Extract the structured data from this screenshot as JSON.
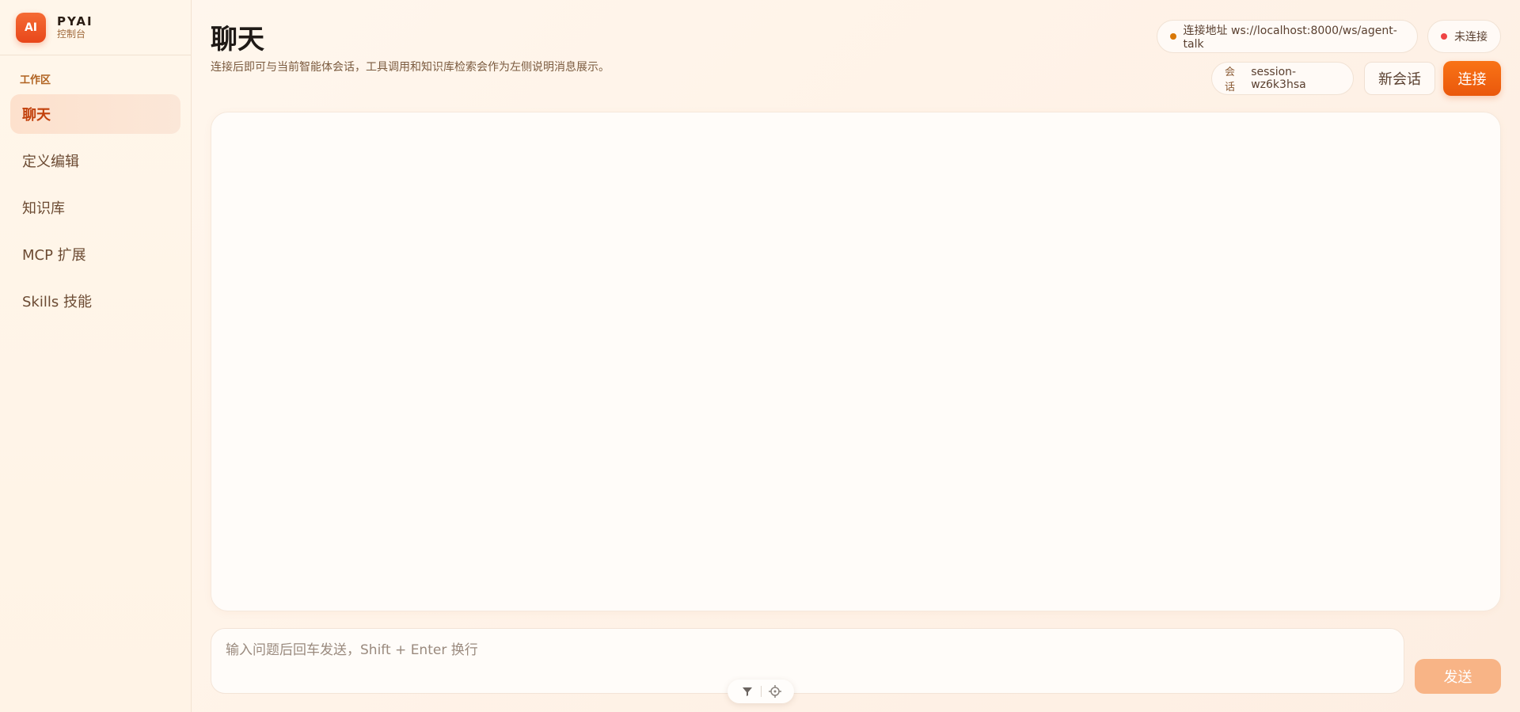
{
  "brand": {
    "logo": "AI",
    "name": "PYAI",
    "subtitle": "控制台"
  },
  "sidebar": {
    "section_label": "工作区",
    "items": [
      {
        "label": "聊天",
        "active": true
      },
      {
        "label": "定义编辑"
      },
      {
        "label": "知识库"
      },
      {
        "label": "MCP 扩展"
      },
      {
        "label": "Skills 技能"
      }
    ]
  },
  "header": {
    "title": "聊天",
    "description": "连接后即可与当前智能体会话，工具调用和知识库检索会作为左侧说明消息展示。"
  },
  "connection": {
    "address_label": "连接地址 ws://localhost:8000/ws/agent-talk",
    "address_dot_color": "#d97706",
    "status_label": "未连接",
    "status_dot_color": "#ef4444"
  },
  "session": {
    "label": "会话",
    "id": "session-wz6k3hsa"
  },
  "buttons": {
    "new_session": "新会话",
    "connect": "连接",
    "send": "发送"
  },
  "composer": {
    "placeholder": "输入问题后回车发送，Shift + Enter 换行"
  },
  "tools": [
    {
      "icon": "funnel-icon"
    },
    {
      "icon": "crosshair-icon"
    }
  ],
  "colors": {
    "accent": "#ea580c",
    "send_disabled": "#f8b486"
  }
}
